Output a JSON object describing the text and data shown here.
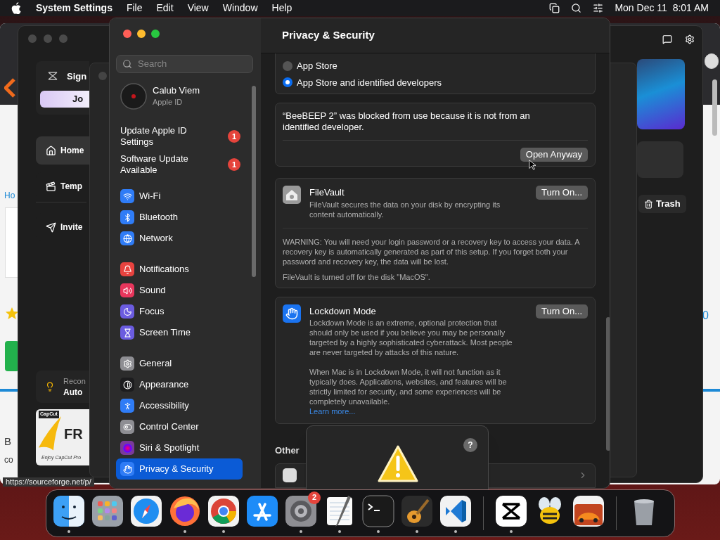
{
  "menu_bar": {
    "app_name": "System Settings",
    "menus": [
      "File",
      "Edit",
      "View",
      "Window",
      "Help"
    ],
    "clock": "Mon Dec 11  8:01 AM"
  },
  "browser_window": {
    "link": "Ho",
    "letter": "B",
    "word": "co",
    "side_number": "0",
    "status_url": "https://sourceforge.net/p/"
  },
  "capcut_window": {
    "sign_in": "Sign",
    "join_button": "Jo",
    "nav": [
      {
        "label": "Home",
        "selected": true
      },
      {
        "label": "Temp",
        "selected": false
      },
      {
        "label": "Invite",
        "selected": false
      }
    ],
    "tip_title": "Recon",
    "tip_text": "Auto",
    "ad": {
      "brand": "CapCut",
      "headline": "FR",
      "tagline": "Enjoy CapCut Pro"
    },
    "trash_button": "Trash"
  },
  "settings": {
    "search": {
      "placeholder": "Search"
    },
    "account": {
      "name": "Calub Viem",
      "subtitle": "Apple ID"
    },
    "alerts": [
      {
        "label": "Update Apple ID Settings",
        "badge": "1"
      },
      {
        "label": "Software Update Available",
        "badge": "1"
      }
    ],
    "groups": [
      [
        {
          "label": "Wi-Fi",
          "color": "#2f7cf6",
          "selected": false
        },
        {
          "label": "Bluetooth",
          "color": "#2f7cf6",
          "selected": false
        },
        {
          "label": "Network",
          "color": "#2f7cf6",
          "selected": false
        }
      ],
      [
        {
          "label": "Notifications",
          "color": "#e8433f",
          "selected": false
        },
        {
          "label": "Sound",
          "color": "#e8365c",
          "selected": false
        },
        {
          "label": "Focus",
          "color": "#6b5ce0",
          "selected": false
        },
        {
          "label": "Screen Time",
          "color": "#6b5ce0",
          "selected": false
        }
      ],
      [
        {
          "label": "General",
          "color": "#8e8e93",
          "selected": false
        },
        {
          "label": "Appearance",
          "color": "#1c1c1e",
          "selected": false
        },
        {
          "label": "Accessibility",
          "color": "#2f7cf6",
          "selected": false
        },
        {
          "label": "Control Center",
          "color": "#8e8e93",
          "selected": false
        },
        {
          "label": "Siri & Spotlight",
          "color": "#7a3a9a",
          "selected": false
        },
        {
          "label": "Privacy & Security",
          "color": "#2f7cf6",
          "selected": true
        }
      ]
    ],
    "title": "Privacy & Security",
    "allow_options": [
      {
        "label": "App Store",
        "selected": false
      },
      {
        "label": "App Store and identified developers",
        "selected": true
      }
    ],
    "blocked": {
      "message": "“BeeBEEP 2” was blocked from use because it is not from an identified developer.",
      "button": "Open Anyway"
    },
    "filevault": {
      "title": "FileVault",
      "description": "FileVault secures the data on your disk by encrypting its content automatically.",
      "button": "Turn On...",
      "warning": "WARNING: You will need your login password or a recovery key to access your data. A recovery key is automatically generated as part of this setup. If you forget both your password and recovery key, the data will be lost.",
      "status": "FileVault is turned off for the disk \"MacOS\"."
    },
    "lockdown": {
      "title": "Lockdown Mode",
      "description": "Lockdown Mode is an extreme, optional protection that should only be used if you believe you may be personally targeted by a highly sophisticated cyberattack. Most people are never targeted by attacks of this nature.",
      "details": "When Mac is in Lockdown Mode, it will not function as it typically does. Applications, websites, and features will be strictly limited for security, and some experiences will be completely unavailable.",
      "link": "Learn more...",
      "button": "Turn On..."
    },
    "other_heading": "Other"
  },
  "alert_dialog": {
    "help": "?"
  },
  "dock": [
    {
      "running": true
    },
    {
      "running": false
    },
    {
      "running": false
    },
    {
      "running": true
    },
    {
      "running": true
    },
    {
      "running": false
    },
    {
      "running": true,
      "badge": "2"
    },
    {
      "running": true
    },
    {
      "running": true
    },
    {
      "running": true
    },
    {
      "running": true
    },
    {
      "running": true
    },
    {
      "running": false
    },
    {
      "running": false
    },
    {
      "running": false
    }
  ]
}
